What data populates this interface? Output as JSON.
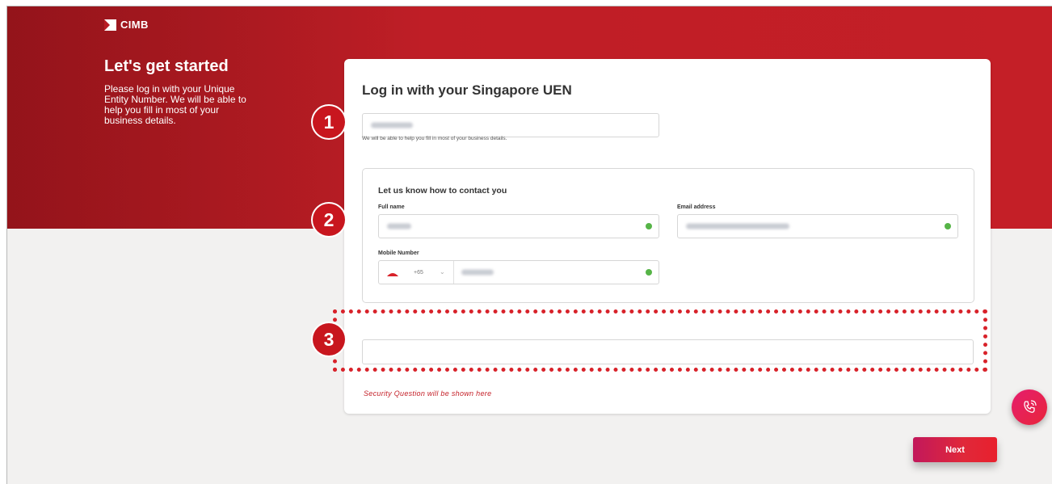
{
  "brand": {
    "name": "CIMB"
  },
  "intro": {
    "heading": "Let's get started",
    "body": "Please log in with your Unique Entity Number. We will be able to help you fill in most of your business details."
  },
  "form": {
    "title": "Log in with your Singapore UEN",
    "uen_hint": "We will be able to help you fill in most of your business details.",
    "contact": {
      "title": "Let us know how to contact you",
      "full_name_label": "Full name",
      "email_label": "Email address",
      "mobile_label": "Mobile Number",
      "country_code": "+65"
    },
    "security_question_note": "Security Question will be shown here",
    "next_label": "Next"
  },
  "badges": [
    "1",
    "2",
    "3"
  ],
  "colors": {
    "brand_red": "#c41f27",
    "success_green": "#56b447",
    "annotation_red": "#d8222a"
  }
}
